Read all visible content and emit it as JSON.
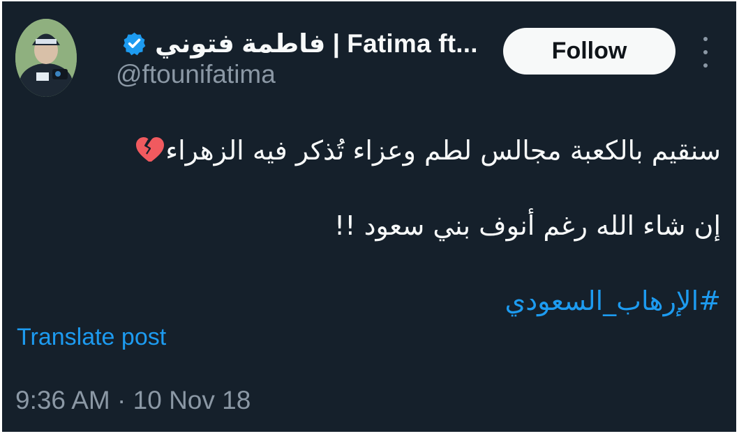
{
  "author": {
    "display_name": "فاطمة فتوني | Fatima ft...",
    "handle": "@ftounifatima",
    "verified_icon": "verified-badge-icon",
    "avatar_icon": "avatar"
  },
  "actions": {
    "follow_label": "Follow",
    "more_icon": "more-vertical-icon"
  },
  "post": {
    "line_1": "سنقيم بالكعبة مجالس لطم وعزاء تُذكر فيه الزهراء",
    "line_1_emoji": "broken-heart-icon",
    "line_2": "إن شاء الله رغم أنوف بني سعود !!",
    "hashtag": "#الإرهاب_السعودي"
  },
  "translate_label": "Translate post",
  "timestamp": "9:36 AM · 10 Nov 18",
  "colors": {
    "background": "#15202b",
    "text": "#f7f9f9",
    "secondary_text": "#8b98a5",
    "accent": "#1d9bf0",
    "follow_button": "#f7f9f9",
    "broken_heart": "#f05a5f"
  }
}
